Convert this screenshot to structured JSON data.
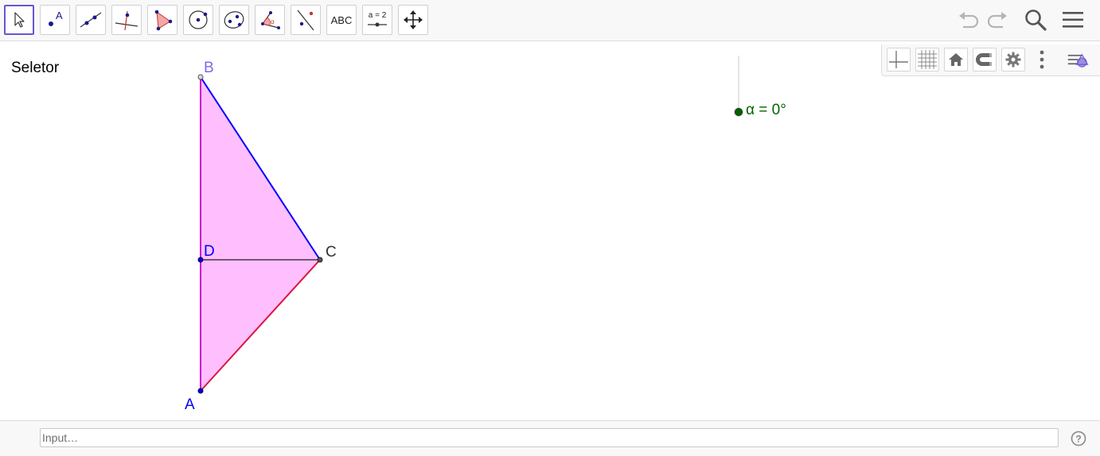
{
  "toolbar": {
    "tools": [
      {
        "id": "move",
        "icon": "pointer-icon",
        "label": ""
      },
      {
        "id": "point",
        "icon": "point-icon",
        "label": "A"
      },
      {
        "id": "line",
        "icon": "line-icon",
        "label": ""
      },
      {
        "id": "perpendicular",
        "icon": "perpendicular-line-icon",
        "label": ""
      },
      {
        "id": "polygon",
        "icon": "polygon-icon",
        "label": ""
      },
      {
        "id": "circle",
        "icon": "circle-icon",
        "label": ""
      },
      {
        "id": "conic",
        "icon": "ellipse-icon",
        "label": ""
      },
      {
        "id": "angle",
        "icon": "angle-icon",
        "label": "α"
      },
      {
        "id": "reflect",
        "icon": "reflect-icon",
        "label": ""
      },
      {
        "id": "text",
        "icon": "text-icon",
        "label": "ABC"
      },
      {
        "id": "slider",
        "icon": "slider-icon",
        "label": "a = 2"
      },
      {
        "id": "move-view",
        "icon": "move-graphics-icon",
        "label": ""
      }
    ],
    "undo_icon": "undo-icon",
    "redo_icon": "redo-icon",
    "search_icon": "search-icon",
    "menu_icon": "menu-icon"
  },
  "graphics": {
    "view_title": "Seletor",
    "style_bar": {
      "buttons": [
        "axes-icon",
        "grid-icon",
        "home-icon",
        "magnet-icon",
        "gear-icon",
        "more-vertical-icon",
        "style-bar-toggle-icon"
      ]
    },
    "points": {
      "A": {
        "label": "A"
      },
      "B": {
        "label": "B"
      },
      "C": {
        "label": "C"
      },
      "D": {
        "label": "D"
      }
    },
    "slider_label": "α = 0°"
  },
  "colors": {
    "polygon_fill": "#ffbfff",
    "segment_AB": "#cc00cc",
    "segment_BC": "#0000ff",
    "segment_CA": "#dc143c",
    "segment_DC": "#1a1a1a",
    "label_blue": "#0000ff",
    "label_purple": "#7b68ee",
    "slider_green": "#006400",
    "selected_tool": "#6557d2"
  },
  "input_bar": {
    "placeholder": "Input…",
    "value": "",
    "help_icon": "help-icon"
  }
}
